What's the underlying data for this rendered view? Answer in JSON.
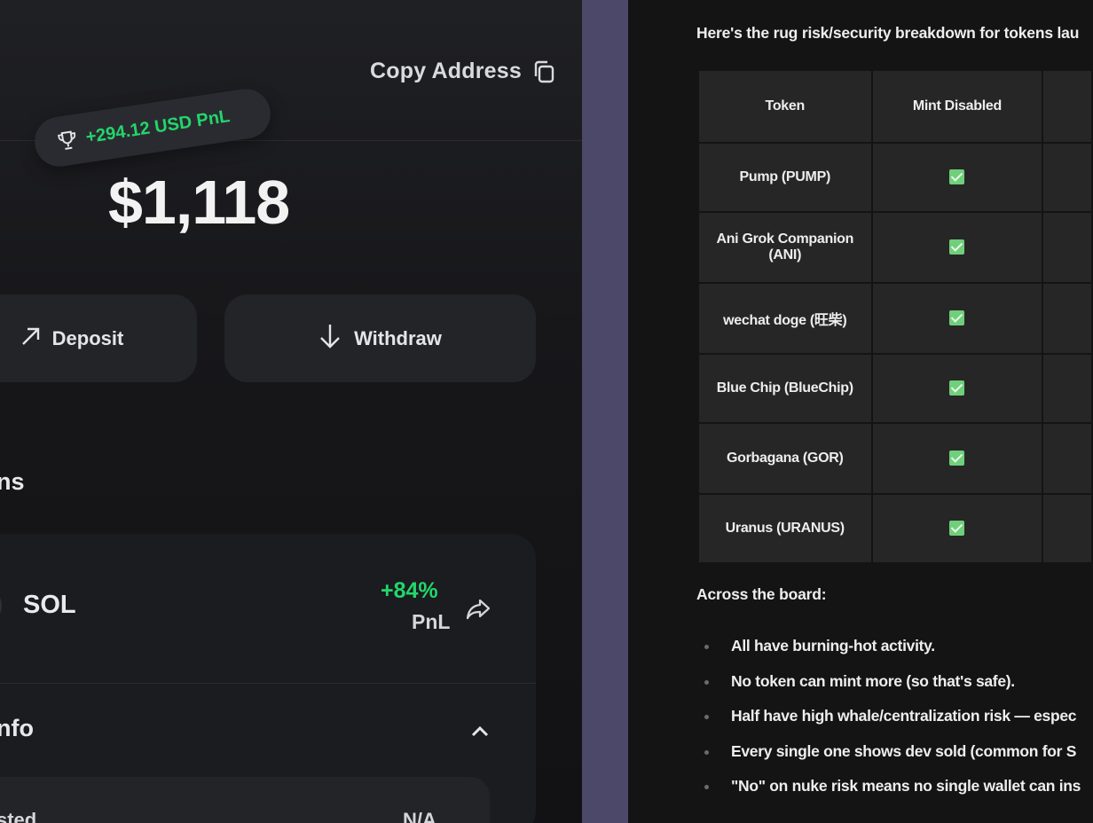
{
  "wallet": {
    "copy_address_label": "Copy Address",
    "pnl_badge": "+294.12 USD PnL",
    "balance": "$1,118",
    "deposit_label": "Deposit",
    "withdraw_label": "Withdraw",
    "assets_section_title": "ns",
    "assets": [
      {
        "symbol": "SOL",
        "pnl_percent": "+84%",
        "pnl_label": "PnL"
      }
    ],
    "info_section_title": "nfo",
    "info_rows": [
      {
        "label": "sted",
        "value": "N/A"
      }
    ],
    "colors": {
      "positive": "#22d66b",
      "background": "#17171a",
      "card": "#232428"
    }
  },
  "chat": {
    "intro": "Here's the rug risk/security breakdown for tokens lau",
    "table": {
      "headers": [
        "Token",
        "Mint Disabled",
        ""
      ],
      "rows": [
        {
          "token": "Pump (PUMP)",
          "mint_disabled": true
        },
        {
          "token": "Ani Grok Companion (ANI)",
          "mint_disabled": true
        },
        {
          "token": "wechat doge (旺柴)",
          "mint_disabled": true
        },
        {
          "token": "Blue Chip (BlueChip)",
          "mint_disabled": true
        },
        {
          "token": "Gorbagana (GOR)",
          "mint_disabled": true
        },
        {
          "token": "Uranus (URANUS)",
          "mint_disabled": true
        }
      ]
    },
    "summary_title": "Across the board:",
    "bullets": [
      "All have burning-hot activity.",
      "No token can mint more (so that's safe).",
      "Half have high whale/centralization risk — espec",
      "Every single one shows dev sold (common for S",
      "\"No\" on nuke risk means no single wallet can ins"
    ],
    "colors": {
      "check": "#6fcf7a",
      "divider_strip": "#4b4869"
    }
  }
}
